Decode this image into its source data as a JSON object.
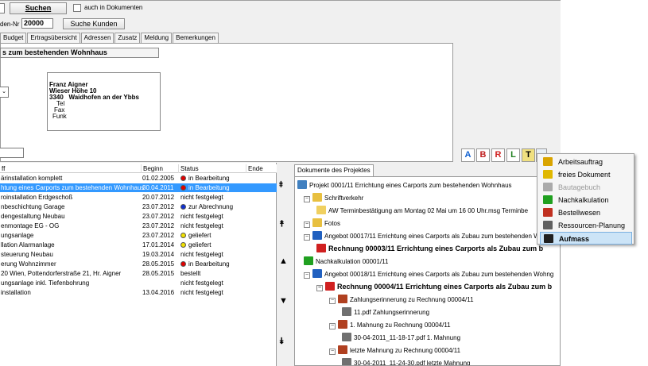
{
  "top": {
    "search_button": "Suchen",
    "docs_checkbox": "auch in Dokumenten",
    "customer_label": "den-Nr",
    "customer_no": "20000",
    "search_customer_button": "Suche Kunden"
  },
  "tabs": [
    "Budget",
    "Ertragsübersicht",
    "Adressen",
    "Zusatz",
    "Meldung",
    "Bemerkungen"
  ],
  "project_title": "s zum bestehenden Wohnhaus",
  "address": {
    "name": "Franz Aigner",
    "street": "Wieser Höhe 10",
    "zip": "3340",
    "city": "Waidhofen an der Ybbs",
    "tel": "Tel",
    "fax": "Fax",
    "funk": "Funk"
  },
  "table": {
    "headers": [
      "ff",
      "Beginn",
      "Status",
      "Ende"
    ],
    "rows": [
      {
        "name": "ärinstallation komplett",
        "begin": "01.02.2005",
        "status": "in Bearbeitung",
        "color": "#e00000"
      },
      {
        "name": "htung eines Carports zum bestehenden Wohnhaus",
        "begin": "30.04.2011",
        "status": "in Bearbeitung",
        "color": "#e00000"
      },
      {
        "name": "roinstallation Erdgeschoß",
        "begin": "20.07.2012",
        "status": "nicht festgelegt",
        "color": ""
      },
      {
        "name": "nbeschichtung Garage",
        "begin": "23.07.2012",
        "status": "zur Abrechnung",
        "color": "#1030d0"
      },
      {
        "name": "dengestaltung Neubau",
        "begin": "23.07.2012",
        "status": "nicht festgelegt",
        "color": ""
      },
      {
        "name": "enmontage EG - OG",
        "begin": "23.07.2012",
        "status": "nicht festgelegt",
        "color": ""
      },
      {
        "name": "ungsanlage",
        "begin": "23.07.2012",
        "status": "geliefert",
        "color": "#f0e000"
      },
      {
        "name": "llation Alarmanlage",
        "begin": "17.01.2014",
        "status": "geliefert",
        "color": "#f0e000"
      },
      {
        "name": "steuerung Neubau",
        "begin": "19.03.2014",
        "status": "nicht festgelegt",
        "color": ""
      },
      {
        "name": "erung Wohnzimmer",
        "begin": "28.05.2015",
        "status": "in Bearbeitung",
        "color": "#e00000"
      },
      {
        "name": "20 Wien, Pottendorferstraße 21, Hr. Aigner",
        "begin": "28.05.2015",
        "status": "bestellt",
        "color": ""
      },
      {
        "name": "ungsanlage inkl. Tiefenbohrung",
        "begin": "",
        "status": "nicht festgelegt",
        "color": ""
      },
      {
        "name": "installation",
        "begin": "13.04.2016",
        "status": "nicht festgelegt",
        "color": ""
      }
    ]
  },
  "tree": {
    "tab": "Dokumente des Projektes",
    "nodes": [
      "Projekt 0001/11 Errichtung eines Carports zum bestehenden Wohnhaus",
      "Schriftverkehr",
      "AW  Terminbestätigung am Montag 02  Mai um 16 00 Uhr.msg Terminbe",
      "Fotos",
      "Angebot 00017/11 Errichtung eines Carports als Zubau zum bestehenden Wo",
      "Rechnung 00003/11 Errichtung eines Carports als Zubau zum b",
      "Nachkalkulation 00001/11",
      "Angebot 00018/11 Errichtung eines Carports als Zubau zum bestehenden Wohng",
      "Rechnung 00004/11 Errichtung eines Carports als Zubau zum b",
      "Zahlungserinnerung zu Rechnung 00004/11",
      "11.pdf Zahlungserinnerung",
      "1. Mahnung zu Rechnung 00004/11",
      "30-04-2011_11-18-17.pdf 1. Mahnung",
      "letzte Mahnung zu Rechnung 00004/11",
      "30-04-2011_11-24-30.pdf letzte Mahnung"
    ]
  },
  "menu": {
    "items": [
      {
        "label": "Arbeitsauftrag",
        "icon": "arbeitsauftrag-icon",
        "enabled": true,
        "color": "#d9a400"
      },
      {
        "label": "freies Dokument",
        "icon": "freies-dokument-icon",
        "enabled": true,
        "color": "#e0b800"
      },
      {
        "label": "Bautagebuch",
        "icon": "bautagebuch-icon",
        "enabled": false,
        "color": "#aaaaaa"
      },
      {
        "label": "Nachkalkulation",
        "icon": "nachkalkulation-icon",
        "enabled": true,
        "color": "#20a020"
      },
      {
        "label": "Bestellwesen",
        "icon": "bestellwesen-icon",
        "enabled": true,
        "color": "#c03020"
      },
      {
        "label": "Ressourcen-Planung",
        "icon": "ressourcen-icon",
        "enabled": true,
        "color": "#606060"
      },
      {
        "label": "Aufmass",
        "icon": "aufmass-icon",
        "enabled": true,
        "color": "#202020"
      }
    ]
  },
  "toolbar": [
    "A",
    "B",
    "R",
    "L",
    "T"
  ]
}
